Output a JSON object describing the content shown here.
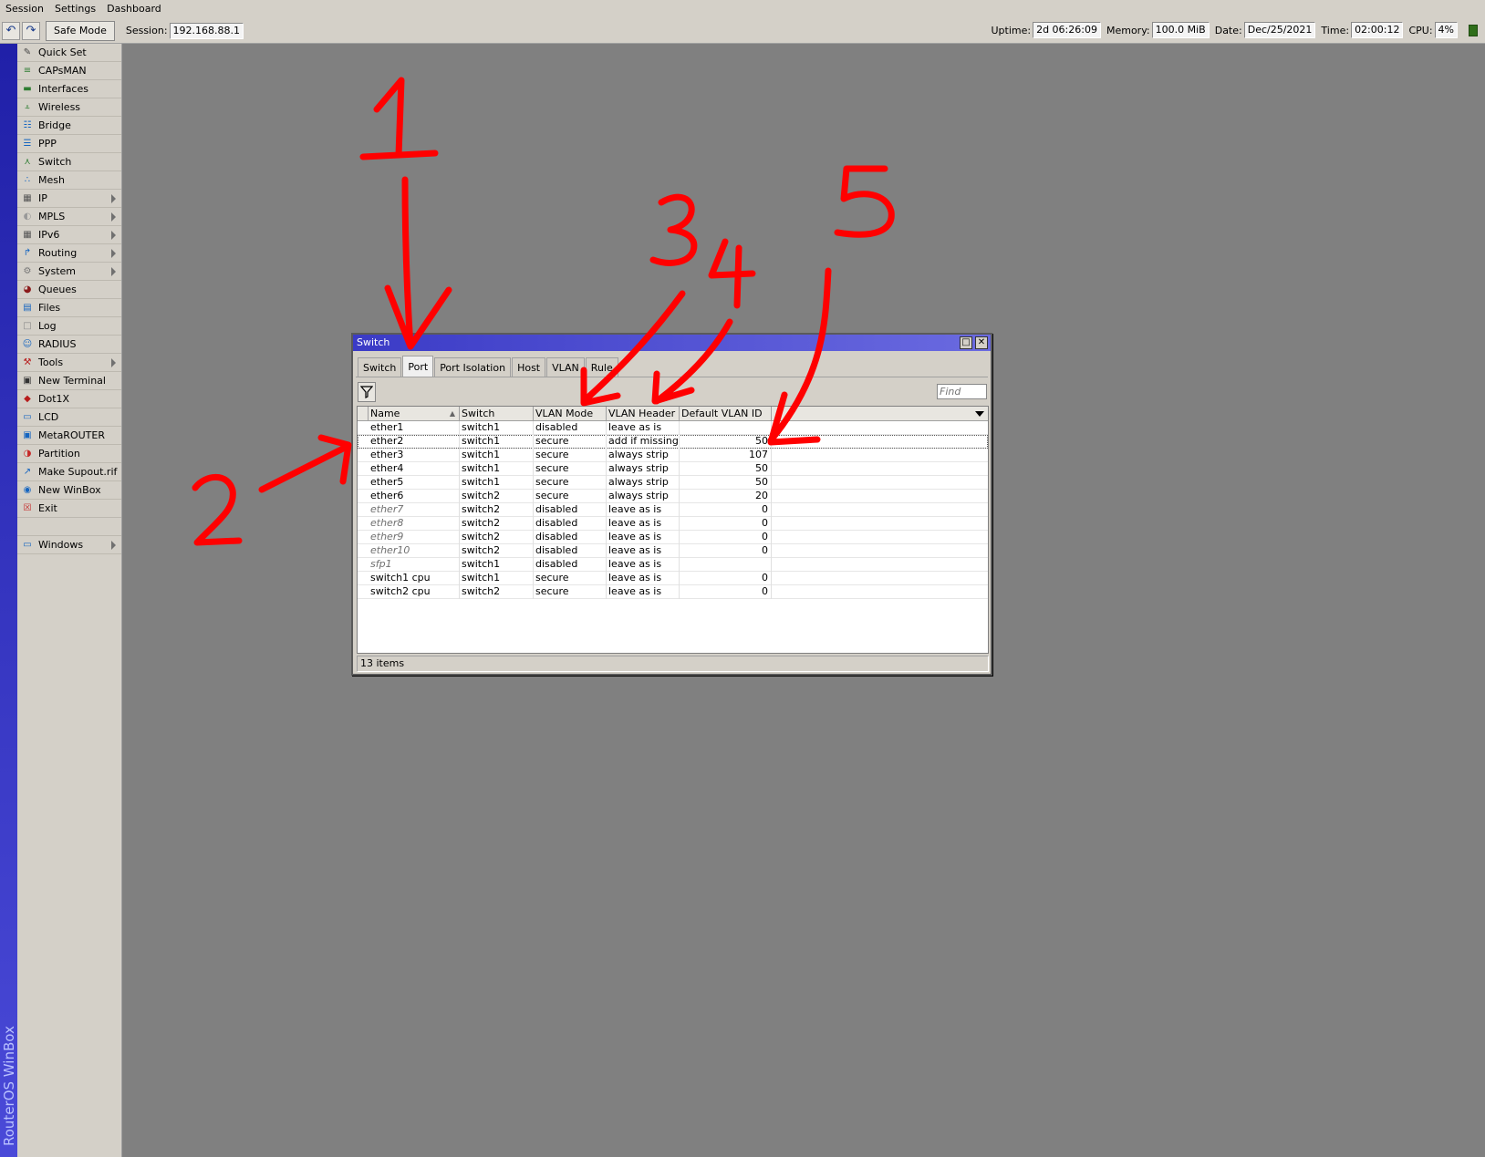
{
  "menubar": {
    "items": [
      "Session",
      "Settings",
      "Dashboard"
    ]
  },
  "toolbar": {
    "undo_icon": "undo-icon",
    "redo_icon": "redo-icon",
    "safe_mode_label": "Safe Mode",
    "session_label": "Session:",
    "session_value": "192.168.88.1",
    "uptime_label": "Uptime:",
    "uptime_value": "2d 06:26:09",
    "memory_label": "Memory:",
    "memory_value": "100.0 MiB",
    "date_label": "Date:",
    "date_value": "Dec/25/2021",
    "time_label": "Time:",
    "time_value": "02:00:12",
    "cpu_label": "CPU:",
    "cpu_value": "4%"
  },
  "brand": {
    "text": "RouterOS WinBox"
  },
  "sidebar": {
    "items": [
      {
        "label": "Quick Set",
        "icon": "wand-icon",
        "submenu": false
      },
      {
        "label": "CAPsMAN",
        "icon": "antenna-icon",
        "submenu": false
      },
      {
        "label": "Interfaces",
        "icon": "interfaces-icon",
        "submenu": false
      },
      {
        "label": "Wireless",
        "icon": "wireless-icon",
        "submenu": false
      },
      {
        "label": "Bridge",
        "icon": "bridge-icon",
        "submenu": false
      },
      {
        "label": "PPP",
        "icon": "ppp-icon",
        "submenu": false
      },
      {
        "label": "Switch",
        "icon": "switch-icon",
        "submenu": false
      },
      {
        "label": "Mesh",
        "icon": "mesh-icon",
        "submenu": false
      },
      {
        "label": "IP",
        "icon": "ip-icon",
        "submenu": true
      },
      {
        "label": "MPLS",
        "icon": "mpls-icon",
        "submenu": true
      },
      {
        "label": "IPv6",
        "icon": "ipv6-icon",
        "submenu": true
      },
      {
        "label": "Routing",
        "icon": "routing-icon",
        "submenu": true
      },
      {
        "label": "System",
        "icon": "system-icon",
        "submenu": true
      },
      {
        "label": "Queues",
        "icon": "queues-icon",
        "submenu": false
      },
      {
        "label": "Files",
        "icon": "files-icon",
        "submenu": false
      },
      {
        "label": "Log",
        "icon": "log-icon",
        "submenu": false
      },
      {
        "label": "RADIUS",
        "icon": "radius-icon",
        "submenu": false
      },
      {
        "label": "Tools",
        "icon": "tools-icon",
        "submenu": true
      },
      {
        "label": "New Terminal",
        "icon": "terminal-icon",
        "submenu": false
      },
      {
        "label": "Dot1X",
        "icon": "dot1x-icon",
        "submenu": false
      },
      {
        "label": "LCD",
        "icon": "lcd-icon",
        "submenu": false
      },
      {
        "label": "MetaROUTER",
        "icon": "metarouter-icon",
        "submenu": false
      },
      {
        "label": "Partition",
        "icon": "partition-icon",
        "submenu": false
      },
      {
        "label": "Make Supout.rif",
        "icon": "supout-icon",
        "submenu": false
      },
      {
        "label": "New WinBox",
        "icon": "winbox-icon",
        "submenu": false
      },
      {
        "label": "Exit",
        "icon": "exit-icon",
        "submenu": false
      }
    ],
    "windows": {
      "label": "Windows",
      "icon": "windows-icon",
      "submenu": true
    }
  },
  "switch_window": {
    "title": "Switch",
    "tabs": [
      {
        "label": "Switch",
        "active": false
      },
      {
        "label": "Port",
        "active": true
      },
      {
        "label": "Port Isolation",
        "active": false
      },
      {
        "label": "Host",
        "active": false
      },
      {
        "label": "VLAN",
        "active": false
      },
      {
        "label": "Rule",
        "active": false
      }
    ],
    "find_placeholder": "Find",
    "columns": [
      "Name",
      "Switch",
      "VLAN Mode",
      "VLAN Header",
      "Default VLAN ID"
    ],
    "rows": [
      {
        "name": "ether1",
        "switch": "switch1",
        "vlan_mode": "disabled",
        "vlan_header": "leave as is",
        "default_vlan_id": "",
        "disabled": false,
        "selected": false
      },
      {
        "name": "ether2",
        "switch": "switch1",
        "vlan_mode": "secure",
        "vlan_header": "add if missing",
        "default_vlan_id": "50",
        "disabled": false,
        "selected": true
      },
      {
        "name": "ether3",
        "switch": "switch1",
        "vlan_mode": "secure",
        "vlan_header": "always strip",
        "default_vlan_id": "107",
        "disabled": false,
        "selected": false
      },
      {
        "name": "ether4",
        "switch": "switch1",
        "vlan_mode": "secure",
        "vlan_header": "always strip",
        "default_vlan_id": "50",
        "disabled": false,
        "selected": false
      },
      {
        "name": "ether5",
        "switch": "switch1",
        "vlan_mode": "secure",
        "vlan_header": "always strip",
        "default_vlan_id": "50",
        "disabled": false,
        "selected": false
      },
      {
        "name": "ether6",
        "switch": "switch2",
        "vlan_mode": "secure",
        "vlan_header": "always strip",
        "default_vlan_id": "20",
        "disabled": false,
        "selected": false
      },
      {
        "name": "ether7",
        "switch": "switch2",
        "vlan_mode": "disabled",
        "vlan_header": "leave as is",
        "default_vlan_id": "0",
        "disabled": true,
        "selected": false
      },
      {
        "name": "ether8",
        "switch": "switch2",
        "vlan_mode": "disabled",
        "vlan_header": "leave as is",
        "default_vlan_id": "0",
        "disabled": true,
        "selected": false
      },
      {
        "name": "ether9",
        "switch": "switch2",
        "vlan_mode": "disabled",
        "vlan_header": "leave as is",
        "default_vlan_id": "0",
        "disabled": true,
        "selected": false
      },
      {
        "name": "ether10",
        "switch": "switch2",
        "vlan_mode": "disabled",
        "vlan_header": "leave as is",
        "default_vlan_id": "0",
        "disabled": true,
        "selected": false
      },
      {
        "name": "sfp1",
        "switch": "switch1",
        "vlan_mode": "disabled",
        "vlan_header": "leave as is",
        "default_vlan_id": "",
        "disabled": true,
        "selected": false
      },
      {
        "name": "switch1 cpu",
        "switch": "switch1",
        "vlan_mode": "secure",
        "vlan_header": "leave as is",
        "default_vlan_id": "0",
        "disabled": false,
        "selected": false
      },
      {
        "name": "switch2 cpu",
        "switch": "switch2",
        "vlan_mode": "secure",
        "vlan_header": "leave as is",
        "default_vlan_id": "0",
        "disabled": false,
        "selected": false
      }
    ],
    "status_text": "13 items"
  },
  "annotations": {
    "labels": [
      "1",
      "2",
      "3",
      "4",
      "5"
    ],
    "color": "#ff0000"
  },
  "colors": {
    "desktop": "#808080",
    "chrome": "#d4d0c8",
    "title_bar": "#3b3bc6",
    "brand_strip": "#2020a8"
  }
}
